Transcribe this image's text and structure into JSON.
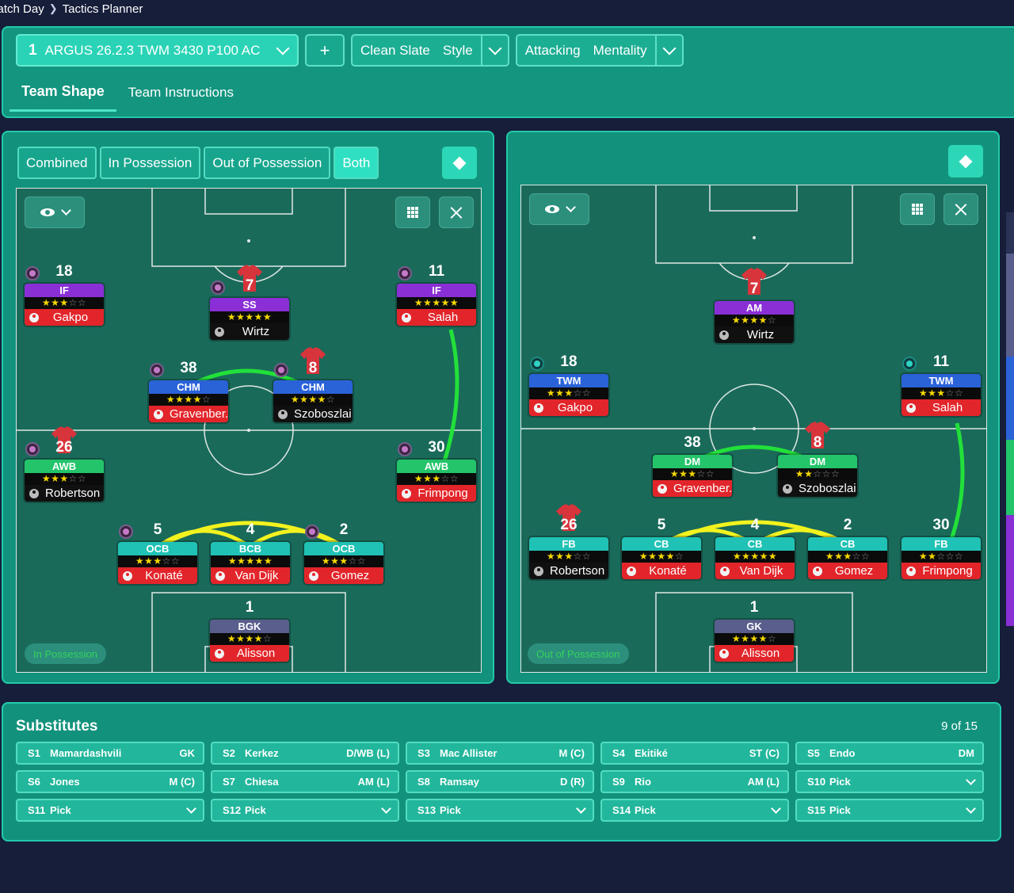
{
  "breadcrumb": {
    "first": "Match Day",
    "current": "Tactics Planner"
  },
  "toolbar": {
    "tactic_number": "1",
    "tactic_name": "ARGUS 26.2.3 TWM 3430 P100 AC",
    "add_label": "+",
    "style_value": "Clean Slate",
    "style_label": "Style",
    "mentality_value": "Attacking",
    "mentality_label": "Mentality"
  },
  "tabs": [
    {
      "label": "Team Shape",
      "active": true
    },
    {
      "label": "Team Instructions",
      "active": false
    }
  ],
  "view_toggle": [
    "Combined",
    "In Possession",
    "Out of Possession",
    "Both"
  ],
  "left_pitch": {
    "mode_label": "In Possession",
    "players": [
      {
        "num": "18",
        "pos": "IF",
        "color": "purple",
        "stars": 3,
        "name": "Gakpo",
        "name_style": "red",
        "shirt": false,
        "badge": "purple"
      },
      {
        "num": "7",
        "pos": "SS",
        "color": "purple",
        "stars": 4.5,
        "name": "Wirtz",
        "name_style": "dark",
        "shirt": true,
        "badge": "purple"
      },
      {
        "num": "11",
        "pos": "IF",
        "color": "purple",
        "stars": 4.5,
        "name": "Salah",
        "name_style": "red",
        "shirt": false,
        "badge": "purple"
      },
      {
        "num": "38",
        "pos": "CHM",
        "color": "blue",
        "stars": 3.5,
        "name": "Gravenber...",
        "name_style": "red",
        "shirt": false,
        "badge": "purple"
      },
      {
        "num": "8",
        "pos": "CHM",
        "color": "blue",
        "stars": 3.5,
        "name": "Szoboszlai",
        "name_style": "dark",
        "shirt": true,
        "badge": "purple"
      },
      {
        "num": "26",
        "pos": "AWB",
        "color": "green",
        "stars": 2.5,
        "name": "Robertson",
        "name_style": "dark",
        "shirt": true,
        "badge": "purple"
      },
      {
        "num": "30",
        "pos": "AWB",
        "color": "green",
        "stars": 2.5,
        "name": "Frimpong",
        "name_style": "red",
        "shirt": false,
        "badge": "purple"
      },
      {
        "num": "5",
        "pos": "OCB",
        "color": "cyan",
        "stars": 3,
        "name": "Konaté",
        "name_style": "red",
        "shirt": false,
        "badge": "purple"
      },
      {
        "num": "4",
        "pos": "BCB",
        "color": "cyan",
        "stars": 4.5,
        "name": "Van Dijk",
        "name_style": "red",
        "shirt": false,
        "badge": "none"
      },
      {
        "num": "2",
        "pos": "OCB",
        "color": "cyan",
        "stars": 2.5,
        "name": "Gomez",
        "name_style": "red",
        "shirt": false,
        "badge": "purple"
      },
      {
        "num": "1",
        "pos": "BGK",
        "color": "slate",
        "stars": 4,
        "name": "Alisson",
        "name_style": "red",
        "shirt": false,
        "badge": "none"
      }
    ]
  },
  "right_pitch": {
    "mode_label": "Out of Possession",
    "players": [
      {
        "num": "7",
        "pos": "AM",
        "color": "purple",
        "stars": 4,
        "name": "Wirtz",
        "name_style": "dark",
        "shirt": true,
        "badge": "none"
      },
      {
        "num": "18",
        "pos": "TWM",
        "color": "blue",
        "stars": 2.5,
        "name": "Gakpo",
        "name_style": "red",
        "shirt": false,
        "badge": "teal"
      },
      {
        "num": "11",
        "pos": "TWM",
        "color": "blue",
        "stars": 3,
        "name": "Salah",
        "name_style": "red",
        "shirt": false,
        "badge": "teal"
      },
      {
        "num": "38",
        "pos": "DM",
        "color": "green",
        "stars": 3,
        "name": "Gravenber...",
        "name_style": "red",
        "shirt": false,
        "badge": "none"
      },
      {
        "num": "8",
        "pos": "DM",
        "color": "green",
        "stars": 2,
        "name": "Szoboszlai",
        "name_style": "dark",
        "shirt": true,
        "badge": "none"
      },
      {
        "num": "26",
        "pos": "FB",
        "color": "cyan",
        "stars": 2.5,
        "name": "Robertson",
        "name_style": "dark",
        "shirt": true,
        "badge": "none"
      },
      {
        "num": "5",
        "pos": "CB",
        "color": "cyan",
        "stars": 3.5,
        "name": "Konaté",
        "name_style": "red",
        "shirt": false,
        "badge": "none"
      },
      {
        "num": "4",
        "pos": "CB",
        "color": "cyan",
        "stars": 4.5,
        "name": "Van Dijk",
        "name_style": "red",
        "shirt": false,
        "badge": "none"
      },
      {
        "num": "2",
        "pos": "CB",
        "color": "cyan",
        "stars": 2.5,
        "name": "Gomez",
        "name_style": "red",
        "shirt": false,
        "badge": "none"
      },
      {
        "num": "30",
        "pos": "FB",
        "color": "cyan",
        "stars": 2,
        "name": "Frimpong",
        "name_style": "red",
        "shirt": false,
        "badge": "none"
      },
      {
        "num": "1",
        "pos": "GK",
        "color": "slate",
        "stars": 4,
        "name": "Alisson",
        "name_style": "red",
        "shirt": false,
        "badge": "none"
      }
    ]
  },
  "substitutes": {
    "title": "Substitutes",
    "count": "9 of 15",
    "slots": [
      {
        "slot": "S1",
        "name": "Mamardashvili",
        "pos": "GK"
      },
      {
        "slot": "S2",
        "name": "Kerkez",
        "pos": "D/WB (L)"
      },
      {
        "slot": "S3",
        "name": "Mac Allister",
        "pos": "M (C)"
      },
      {
        "slot": "S4",
        "name": "Ekitiké",
        "pos": "ST (C)"
      },
      {
        "slot": "S5",
        "name": "Endo",
        "pos": "DM"
      },
      {
        "slot": "S6",
        "name": "Jones",
        "pos": "M (C)"
      },
      {
        "slot": "S7",
        "name": "Chiesa",
        "pos": "AM (L)"
      },
      {
        "slot": "S8",
        "name": "Ramsay",
        "pos": "D (R)"
      },
      {
        "slot": "S9",
        "name": "Rio",
        "pos": "AM (L)"
      },
      {
        "slot": "S10",
        "name": "Pick",
        "pos": ""
      },
      {
        "slot": "S11",
        "name": "Pick",
        "pos": ""
      },
      {
        "slot": "S12",
        "name": "Pick",
        "pos": ""
      },
      {
        "slot": "S13",
        "name": "Pick",
        "pos": ""
      },
      {
        "slot": "S14",
        "name": "Pick",
        "pos": ""
      },
      {
        "slot": "S15",
        "name": "Pick",
        "pos": ""
      }
    ]
  },
  "colors": {
    "panel": "#12927c",
    "panel_border": "#22c9aa",
    "pitch": "#1a6a5a",
    "link_green": "#22e03a",
    "link_yellow": "#f2f21e",
    "name_red": "#e2252a"
  },
  "icons": [
    "eye-icon",
    "chevron-down-icon",
    "grid-icon",
    "expand-icon",
    "diamond-icon",
    "person-icon",
    "shirt-icon",
    "trait-badge-icon"
  ]
}
